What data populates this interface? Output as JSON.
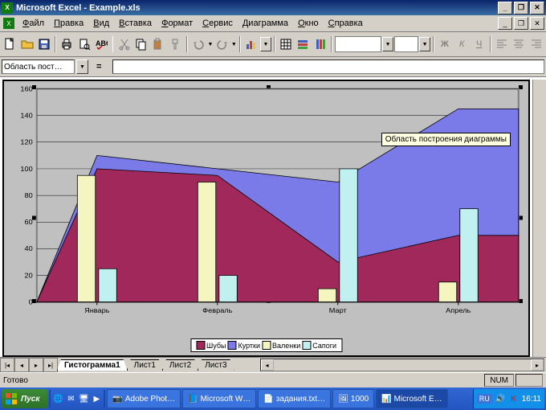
{
  "title": "Microsoft Excel - Example.xls",
  "menu": [
    "Файл",
    "Правка",
    "Вид",
    "Вставка",
    "Формат",
    "Сервис",
    "Диаграмма",
    "Окно",
    "Справка"
  ],
  "namebox": "Область пост…",
  "formula": "=",
  "sheets": {
    "active": "Гистограмма1",
    "others": [
      "Лист1",
      "Лист2",
      "Лист3"
    ]
  },
  "status": "Готово",
  "status_num": "NUM",
  "tooltip": "Область построения диаграммы",
  "legend": [
    "Шубы",
    "Куртки",
    "Валенки",
    "Сапоги"
  ],
  "taskbar": {
    "start": "Пуск",
    "items": [
      {
        "label": "Adobe Phot…",
        "active": false
      },
      {
        "label": "Microsoft W…",
        "active": false
      },
      {
        "label": "задания.txt…",
        "active": false
      },
      {
        "label": "1000",
        "active": false
      },
      {
        "label": "Microsoft E…",
        "active": true
      }
    ],
    "lang": "RU",
    "clock": "16:11"
  },
  "chart_data": {
    "type": "combo",
    "categories": [
      "Январь",
      "Февраль",
      "Март",
      "Апрель"
    ],
    "series": [
      {
        "name": "Шубы",
        "type": "area",
        "color": "#a0285a",
        "values": [
          100,
          95,
          30,
          50
        ]
      },
      {
        "name": "Куртки",
        "type": "area",
        "color": "#7a7ae8",
        "values": [
          110,
          100,
          90,
          145
        ]
      },
      {
        "name": "Валенки",
        "type": "bar",
        "color": "#f5f5c0",
        "values": [
          95,
          90,
          10,
          15
        ]
      },
      {
        "name": "Сапоги",
        "type": "bar",
        "color": "#c0f0f0",
        "values": [
          25,
          20,
          100,
          70
        ]
      }
    ],
    "ylim": [
      0,
      160
    ],
    "yticks": [
      0,
      20,
      40,
      60,
      80,
      100,
      120,
      140,
      160
    ],
    "xlabel": "",
    "ylabel": "",
    "title": ""
  },
  "colors": {
    "plot_bg": "#c0c0c0",
    "area1": "#a0285a",
    "area2": "#7a7ae8",
    "bar1": "#f5f5c0",
    "bar2": "#c0f0f0"
  }
}
